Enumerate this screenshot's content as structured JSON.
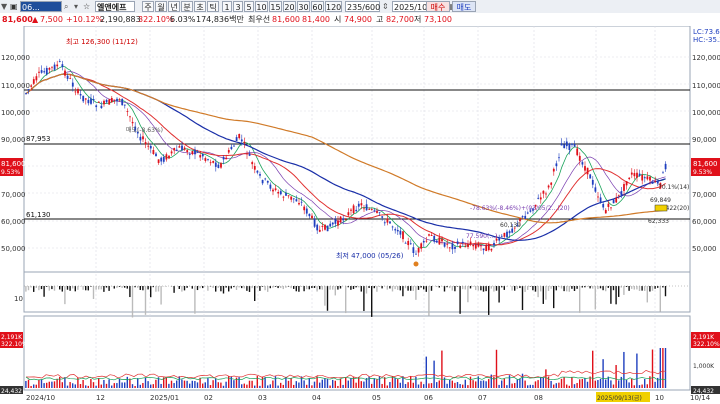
{
  "toolbar": {
    "code": "06...",
    "name": "엘앤에프",
    "periods": [
      "주",
      "월",
      "년",
      "분",
      "초",
      "틱"
    ],
    "intervals": [
      "1",
      "3",
      "5",
      "10",
      "15",
      "20",
      "30",
      "60",
      "120"
    ],
    "count": "235/600",
    "date": "2025/10/14",
    "buy": "매수",
    "sell": "매도"
  },
  "quote": {
    "price": "81,600",
    "change": "7,500",
    "change_pct": "+10.12%",
    "volume": "2,190,883",
    "vol_ratio": "322.10%",
    "rate": "6.03%",
    "amount": "174,836백만",
    "best_ask_label": "최우선",
    "ask": "81,600",
    "bid": "81,400",
    "open_label": "시",
    "open": "74,900",
    "high_label": "고",
    "high": "82,700",
    "low_label": "저",
    "low": "73,100"
  },
  "top_right": {
    "lc": "LC:73.62",
    "hc": "HC:-35.39"
  },
  "main_chart": {
    "price_axis_left": [
      "120,000",
      "110,000",
      "100,000",
      "90,000",
      "80,000",
      "70,000",
      "60,000",
      "50,000"
    ],
    "price_axis_right": [
      "120,000",
      "110,000",
      "100,000",
      "90,000",
      "80,000",
      "70,000",
      "60,000",
      "50,000"
    ],
    "current_price_label": "81,600",
    "current_pct_label": "9.53%",
    "left_price_label": "81,600",
    "left_pct_label": "9.53%",
    "hline_1": "87,953",
    "hline_2": "61,130",
    "annotation_high": "최고 126,300 (11/12)",
    "annotation_low": "최저 47,000 (05/26)",
    "annotation_mid": "-78.63%(-8.46%)+(03/05/2…(20)",
    "annotation_mid2": "77.590(...)",
    "annotation_mid3": "60,139",
    "annotation_right1": "70.1%(14)",
    "annotation_right2": "69,849",
    "annotation_right3": "64,422(20)",
    "annotation_right4": "62,333",
    "annotation_left": "매도(-8.63%)"
  },
  "volume_panel": {
    "label": "10"
  },
  "lower_panel": {
    "left_top": "2,191K",
    "left_pct": "322.10%",
    "left_bottom": "24,432",
    "right_top": "2,191K",
    "right_pct": "322.10%",
    "right_mid": "1,000K",
    "right_bottom": "24,432"
  },
  "time_axis": [
    "2024/10",
    "12",
    "2025/01",
    "02",
    "03",
    "04",
    "05",
    "06",
    "07",
    "08",
    "2025/09/13(금)",
    "10",
    "10/14"
  ],
  "colors": {
    "up": "#e0101a",
    "down": "#1f3fbf",
    "ma_short": "#e03030",
    "ma_mid": "#1a2fa8",
    "ma_long": "#d07a28",
    "ma_green": "#19a35a"
  }
}
